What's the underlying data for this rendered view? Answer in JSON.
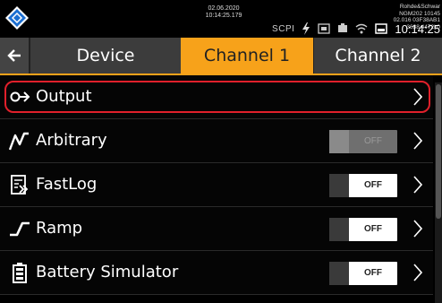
{
  "status": {
    "date": "02.06.2020",
    "time_stamp": "10:14:25.179",
    "device_info": [
      "Rohde&Schwar",
      "NGM202 10145",
      "02.016 03F38AB1",
      "3638.4472k0"
    ],
    "scpi": "SCPI",
    "clock": "10:14:25"
  },
  "tabs": {
    "back_icon": "arrow-left-icon",
    "device": "Device",
    "channel1": "Channel 1",
    "channel2": "Channel 2",
    "active": "Channel 1",
    "active_color": "#f7a21a"
  },
  "menu": [
    {
      "label": "Output",
      "icon": "output-arrow-icon",
      "toggle": null,
      "selected": true
    },
    {
      "label": "Arbitrary",
      "icon": "arbitrary-wave-icon",
      "toggle": "OFF",
      "toggle_disabled": true
    },
    {
      "label": "FastLog",
      "icon": "fastlog-icon",
      "toggle": "OFF"
    },
    {
      "label": "Ramp",
      "icon": "ramp-icon",
      "toggle": "OFF"
    },
    {
      "label": "Battery Simulator",
      "icon": "battery-icon",
      "toggle": "OFF"
    }
  ],
  "colors": {
    "selection_outline": "#e0202b",
    "background": "#000000"
  }
}
